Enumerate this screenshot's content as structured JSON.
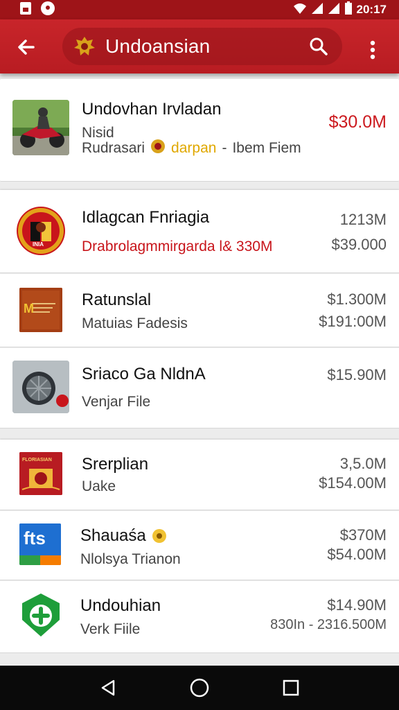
{
  "status_bar": {
    "time": "20:17"
  },
  "app_bar": {
    "title": "Undoansian"
  },
  "featured": {
    "title": "Undovhan Irvladan",
    "subtitle": "Nisid",
    "meta_left": "Rudrasari",
    "meta_gold": "darpan",
    "meta_sep": "-",
    "meta_right": "Ibem Fiem",
    "price": "$30.0M"
  },
  "items": [
    {
      "title": "Idlagcan Fnriagia",
      "subtitle": "Drabrolagmmirgarda l& 330M",
      "subtitle_red": true,
      "price_top": "1213M",
      "price_bottom": "$39.000"
    },
    {
      "title": "Ratunslal",
      "subtitle": "Matuias Fadesis",
      "price_top": "$1.300M",
      "price_bottom": "$191:00M"
    },
    {
      "title": "Sriaco Ga NldnA",
      "subtitle": "Venjar File",
      "price_top": "$15.90M",
      "price_bottom": ""
    },
    {
      "title": "Srerplian",
      "subtitle": "Uake",
      "price_top": "3,5.0M",
      "price_bottom": "$154.00M"
    },
    {
      "title": "Shauaśa",
      "subtitle": "Nlolsya Trianon",
      "price_top": "$370M",
      "price_bottom": "$54.00M"
    },
    {
      "title": "Undouhian",
      "subtitle": "Verk Fiile",
      "price_top": "$14.90M",
      "price_bottom": "830In - 2316.500M"
    }
  ],
  "thumb_text": {
    "badge": "INIA",
    "book": "M",
    "card": "FLORIASIAN",
    "tile": "fts"
  },
  "colors": {
    "brand": "#c8252a",
    "brand_dark": "#9e1418",
    "accent_gold": "#e0a800",
    "price_red": "#cc1a1f"
  },
  "icons": [
    "back-arrow-icon",
    "crest-icon",
    "search-icon",
    "more-vert-icon",
    "nav-back-icon",
    "nav-home-icon",
    "nav-recents-icon"
  ]
}
